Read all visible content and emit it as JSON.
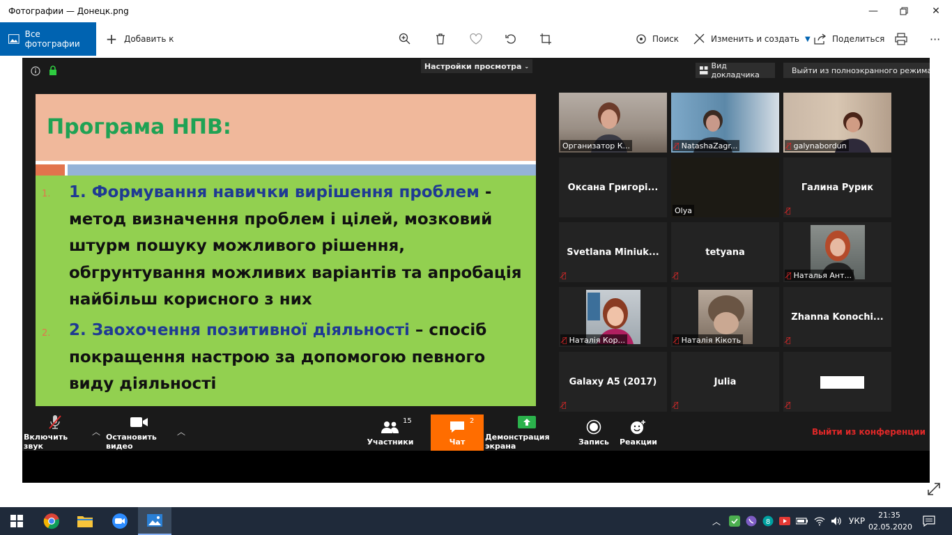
{
  "window": {
    "title": "Фотографии — Донецк.png"
  },
  "toolbar": {
    "all_photos": "Все фотографии",
    "add_to": "Добавить к",
    "search": "Поиск",
    "edit_create": "Изменить и создать",
    "share": "Поделиться"
  },
  "zoom": {
    "view_settings": "Настройки просмотра",
    "speaker_view": "Вид докладчика",
    "exit_fullscreen": "Выйти из полноэкранного режима",
    "slide": {
      "title": "Програма НПВ:",
      "item1_num": "1.",
      "item1_head": "1. Формування навички вирішення проблем",
      "item1_body": " - метод визначення проблем і цілей, мозковий штурм пошуку можливого рішення, обгрунтування можливих варіантів та апробація найбільш корисного з них",
      "item2_num": "2.",
      "item2_head": "2. Заохочення позитивної діяльності",
      "item2_body": " – спосіб покращення настрою за допомогою певного виду діяльності"
    },
    "participants": [
      {
        "name": "Организатор К...",
        "muted": false,
        "kind": "video"
      },
      {
        "name": "NatashaZagr...",
        "muted": true,
        "kind": "video"
      },
      {
        "name": "galynabordun",
        "muted": true,
        "kind": "video"
      },
      {
        "name": "Оксана  Григорі...",
        "muted": false,
        "kind": "name"
      },
      {
        "name": "Olya",
        "muted": false,
        "kind": "dark-video"
      },
      {
        "name": "Галина Рурик",
        "muted": true,
        "kind": "name"
      },
      {
        "name": "Svetlana  Miniuk...",
        "muted": true,
        "kind": "name"
      },
      {
        "name": "tetyana",
        "muted": true,
        "kind": "name"
      },
      {
        "name": "Наталья Ант...",
        "muted": true,
        "kind": "photo"
      },
      {
        "name": "Наталія Кор...",
        "muted": true,
        "kind": "photo"
      },
      {
        "name": "Наталія Кікоть",
        "muted": true,
        "kind": "photo"
      },
      {
        "name": "Zhanna  Konochi...",
        "muted": true,
        "kind": "name"
      },
      {
        "name": "Galaxy A5 (2017)",
        "muted": true,
        "kind": "name"
      },
      {
        "name": "Julia",
        "muted": true,
        "kind": "name"
      },
      {
        "name": "",
        "muted": true,
        "kind": "white-box"
      }
    ],
    "controls": {
      "unmute": "Включить звук",
      "stop_video": "Остановить видео",
      "participants": "Участники",
      "participants_count": "15",
      "chat": "Чат",
      "chat_count": "2",
      "share_screen": "Демонстрация экрана",
      "record": "Запись",
      "reactions": "Реакции",
      "leave": "Выйти из конференции"
    }
  },
  "taskbar": {
    "language": "УКР",
    "time": "21:35",
    "date": "02.05.2020"
  },
  "colors": {
    "accent": "#0063b1",
    "slide_green": "#92d050",
    "slide_header": "#f0b89b",
    "title_green": "#1fa254",
    "chat_orange": "#ff6d00",
    "leave_red": "#e02828"
  }
}
